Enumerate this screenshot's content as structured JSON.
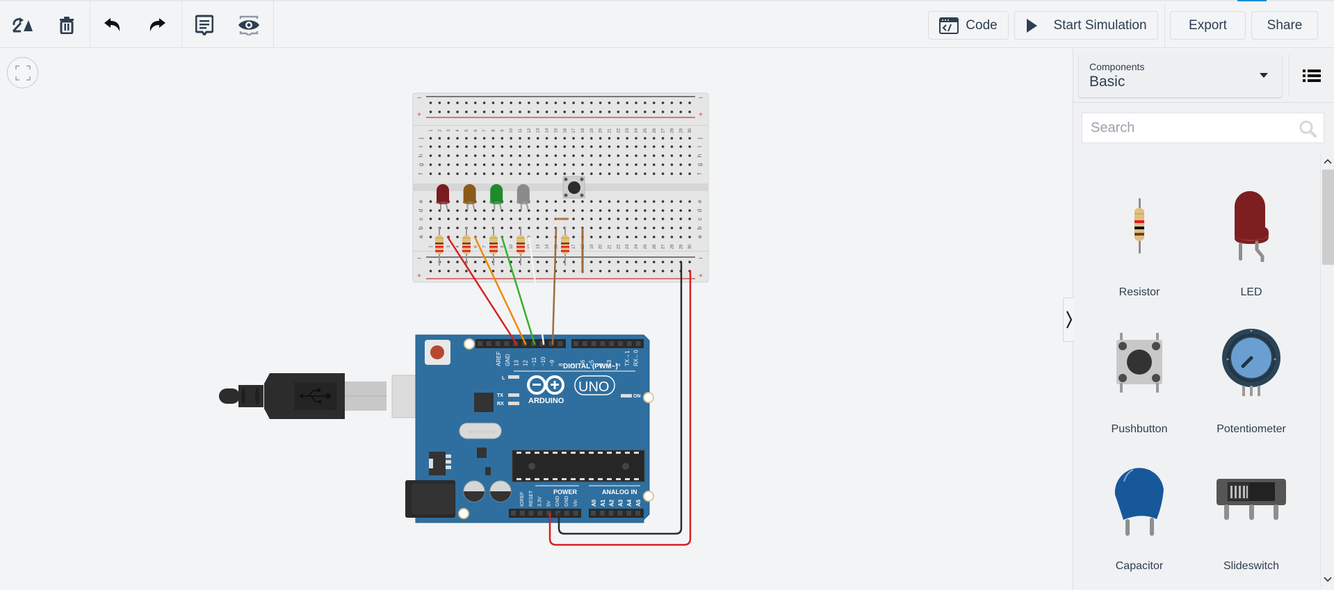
{
  "toolbar": {
    "tools": [
      {
        "name": "rotate",
        "icon": "rotate-icon"
      },
      {
        "name": "delete",
        "icon": "trash-icon"
      },
      {
        "name": "undo",
        "icon": "undo-icon"
      },
      {
        "name": "redo",
        "icon": "redo-icon"
      },
      {
        "name": "notes",
        "icon": "notes-icon"
      },
      {
        "name": "visibility",
        "icon": "eye-icon"
      }
    ],
    "code_label": "Code",
    "start_simulation_label": "Start Simulation",
    "export_label": "Export",
    "share_label": "Share"
  },
  "canvas": {
    "fit_view_icon": "fit-view-icon",
    "breadboard": {
      "columns": 30,
      "row_labels_top": [
        "j",
        "i",
        "h",
        "g",
        "f"
      ],
      "row_labels_bottom": [
        "e",
        "d",
        "c",
        "b",
        "a"
      ],
      "rail_minus": "−",
      "rail_plus": "+",
      "leds": [
        {
          "color": "#7a1c1f"
        },
        {
          "color": "#8a5a1b"
        },
        {
          "color": "#1f8a2a"
        },
        {
          "color": "#8a8a8a"
        }
      ],
      "resistor_count": 5,
      "wires": [
        {
          "color": "#d6211f",
          "to_pin": "13"
        },
        {
          "color": "#f08a00",
          "to_pin": "12"
        },
        {
          "color": "#35b02c",
          "to_pin": "~11"
        },
        {
          "color": "#ffffff",
          "to_pin": "~10"
        },
        {
          "color": "#9a6b3f",
          "to_pin": "~9"
        },
        {
          "color": "#2b2b2b",
          "to_pin": "GND"
        },
        {
          "color": "#d6211f",
          "to_pin": "5V"
        }
      ]
    },
    "arduino": {
      "brand": "ARDUINO",
      "model": "UNO",
      "digital_header_label": "DIGITAL (PWM~)",
      "digital_pins": [
        "AREF",
        "GND",
        "13",
        "12",
        "~11",
        "~10",
        "~9",
        "8",
        "7",
        "~6",
        "~5",
        "4",
        "~3",
        "2",
        "TX→1",
        "RX←0"
      ],
      "power_header_label": "POWER",
      "power_pins": [
        "IOREF",
        "RESET",
        "3.3V",
        "5V",
        "GND",
        "GND",
        "Vin"
      ],
      "analog_header_label": "ANALOG IN",
      "analog_pins": [
        "A0",
        "A1",
        "A2",
        "A3",
        "A4",
        "A5"
      ],
      "led_labels": [
        "L",
        "TX",
        "RX",
        "ON"
      ],
      "crystal_text": "SPK16.000G"
    }
  },
  "panel": {
    "selector_caption": "Components",
    "selector_value": "Basic",
    "list_view_icon": "list-view-icon",
    "search_placeholder": "Search",
    "search_value": "",
    "components": [
      {
        "label": "Resistor",
        "icon": "resistor-icon"
      },
      {
        "label": "LED",
        "icon": "led-icon"
      },
      {
        "label": "Pushbutton",
        "icon": "pushbutton-icon"
      },
      {
        "label": "Potentiometer",
        "icon": "potentiometer-icon"
      },
      {
        "label": "Capacitor",
        "icon": "capacitor-icon"
      },
      {
        "label": "Slideswitch",
        "icon": "slideswitch-icon"
      }
    ],
    "scroll_position": 0
  }
}
